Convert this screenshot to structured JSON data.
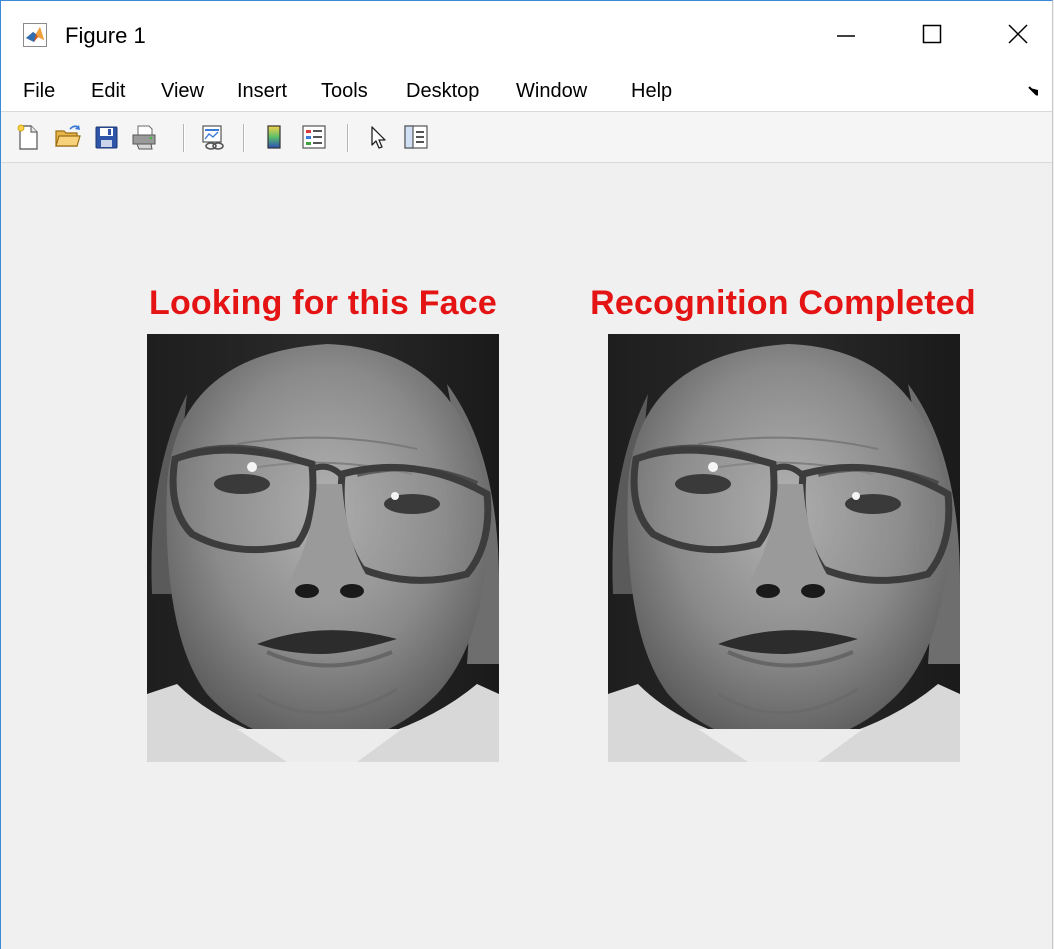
{
  "window": {
    "title": "Figure 1",
    "controls": [
      "minimize",
      "maximize",
      "close"
    ]
  },
  "menubar": {
    "items": [
      {
        "label": "File"
      },
      {
        "label": "Edit"
      },
      {
        "label": "View"
      },
      {
        "label": "Insert"
      },
      {
        "label": "Tools"
      },
      {
        "label": "Desktop"
      },
      {
        "label": "Window"
      },
      {
        "label": "Help"
      }
    ]
  },
  "toolbar": {
    "buttons": [
      "new-figure-icon",
      "open-file-icon",
      "save-icon",
      "print-icon",
      "link-plot-icon",
      "colorbar-icon",
      "legend-icon",
      "edit-plot-pointer-icon",
      "property-inspector-icon"
    ]
  },
  "axes": [
    {
      "title": "Looking for this Face",
      "image": "grayscale face photo of man with glasses"
    },
    {
      "title": "Recognition Completed",
      "image": "grayscale face photo of man with glasses"
    }
  ],
  "colors": {
    "title_red": "#e51414",
    "figure_bg": "#f0f0f0"
  }
}
